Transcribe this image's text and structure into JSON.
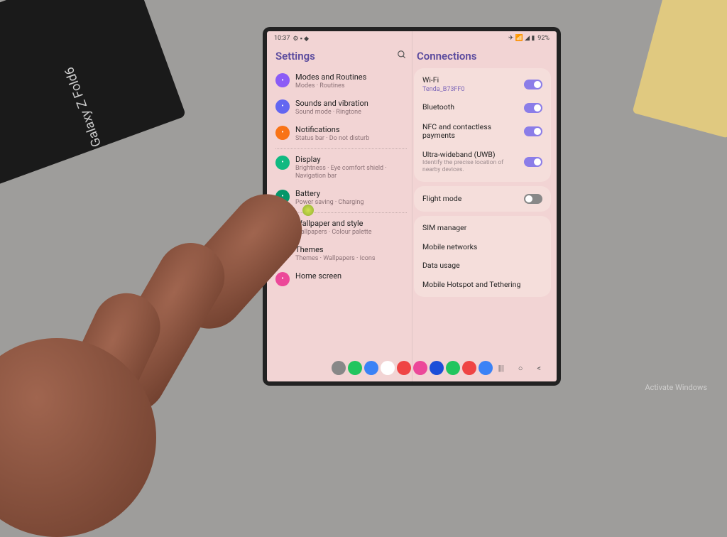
{
  "box_text": "Galaxy Z Fold6",
  "watermark": "Activate Windows",
  "statusbar": {
    "time": "10:37",
    "battery": "92%"
  },
  "left_pane": {
    "title": "Settings",
    "items": [
      {
        "icon_color": "#8b5cf6",
        "title": "Modes and Routines",
        "sub": "Modes · Routines"
      },
      {
        "icon_color": "#6366f1",
        "title": "Sounds and vibration",
        "sub": "Sound mode · Ringtone"
      },
      {
        "icon_color": "#f97316",
        "title": "Notifications",
        "sub": "Status bar · Do not disturb"
      },
      {
        "icon_color": "#10b981",
        "title": "Display",
        "sub": "Brightness · Eye comfort shield · Navigation bar",
        "divider_before": true
      },
      {
        "icon_color": "#059669",
        "title": "Battery",
        "sub": "Power saving · Charging"
      },
      {
        "icon_color": "#e11d48",
        "title": "Wallpaper and style",
        "sub": "Wallpapers · Colour palette",
        "divider_before": true
      },
      {
        "icon_color": "#be185d",
        "title": "Themes",
        "sub": "Themes · Wallpapers · Icons"
      },
      {
        "icon_color": "#ec4899",
        "title": "Home screen",
        "sub": ""
      }
    ]
  },
  "right_pane": {
    "title": "Connections",
    "groups": [
      [
        {
          "title": "Wi-Fi",
          "sub": "Tenda_B73FF0",
          "toggle": true
        },
        {
          "title": "Bluetooth",
          "toggle": true
        },
        {
          "title": "NFC and contactless payments",
          "toggle": true
        },
        {
          "title": "Ultra-wideband (UWB)",
          "desc": "Identify the precise location of nearby devices.",
          "toggle": true
        }
      ],
      [
        {
          "title": "Flight mode",
          "toggle": false
        }
      ],
      [
        {
          "title": "SIM manager"
        },
        {
          "title": "Mobile networks"
        },
        {
          "title": "Data usage"
        },
        {
          "title": "Mobile Hotspot and Tethering"
        }
      ]
    ]
  },
  "dock_colors": [
    "#888",
    "#22c55e",
    "#3b82f6",
    "#fff",
    "#ef4444",
    "#ec4899",
    "#1d4ed8",
    "#22c55e",
    "#ef4444",
    "#3b82f6"
  ]
}
